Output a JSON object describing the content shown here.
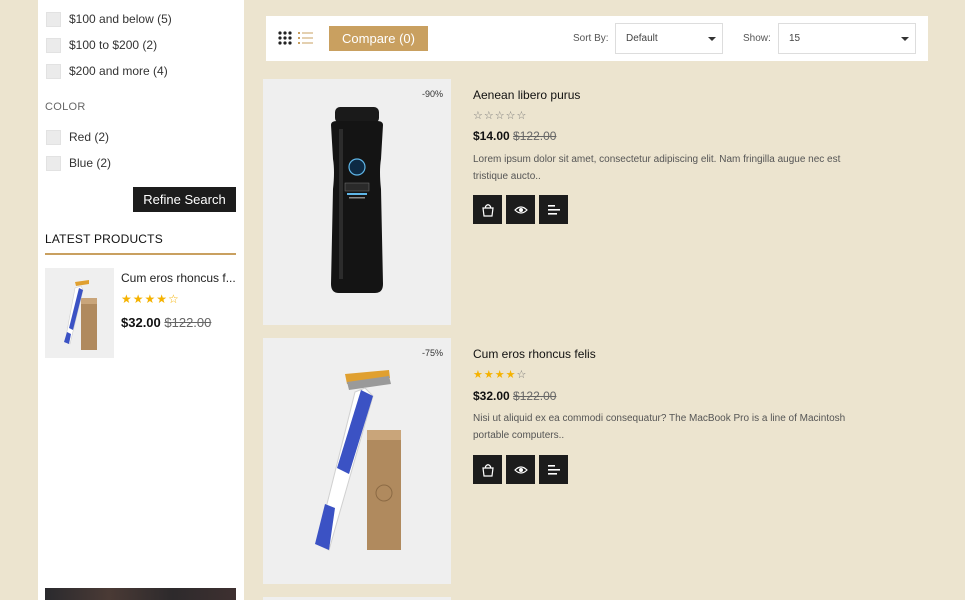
{
  "sidebar": {
    "price_filters": [
      {
        "label": "$100 and below (5)"
      },
      {
        "label": "$100 to $200 (2)"
      },
      {
        "label": "$200 and more (4)"
      }
    ],
    "color_title": "COLOR",
    "color_filters": [
      {
        "label": "Red (2)"
      },
      {
        "label": "Blue (2)"
      }
    ],
    "refine_label": "Refine Search",
    "latest_title": "LATEST PRODUCTS",
    "latest_product": {
      "name": "Cum eros rhoncus f...",
      "rating": 4,
      "stars": "★★★★☆",
      "price": "$32.00",
      "old_price": "$122.00"
    }
  },
  "toolbar": {
    "compare_label": "Compare (0)",
    "sort_label": "Sort By:",
    "sort_value": "Default",
    "show_label": "Show:",
    "show_value": "15"
  },
  "products": [
    {
      "discount": "-90%",
      "name": "Aenean libero purus",
      "rating": 0,
      "stars": "☆☆☆☆☆",
      "price": "$14.00",
      "old_price": "$122.00",
      "description": "Lorem ipsum dolor sit amet, consectetur adipiscing elit. Nam fringilla augue nec est tristique aucto.."
    },
    {
      "discount": "-75%",
      "name": "Cum eros rhoncus felis",
      "rating": 4,
      "stars_on": "★★★★",
      "stars_off": "☆",
      "price": "$32.00",
      "old_price": "$122.00",
      "description": "Nisi ut aliquid ex ea commodi consequatur? The MacBook Pro is a line of Macintosh portable computers.."
    }
  ],
  "icons": {
    "add_to_cart": "shopping-bag-icon",
    "quick_view": "eye-icon",
    "compare": "compare-list-icon",
    "grid_view": "grid-view-icon",
    "list_view": "list-view-icon"
  },
  "colors": {
    "accent": "#c9a060",
    "page_bg": "#ece4cf",
    "dark": "#1c1c1c",
    "star": "#f5b200"
  }
}
